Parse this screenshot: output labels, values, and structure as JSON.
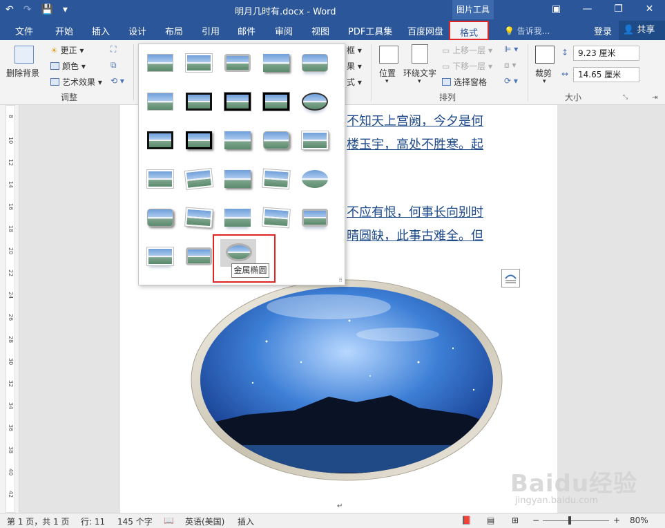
{
  "window": {
    "title": "明月几时有.docx - Word",
    "context_label": "图片工具",
    "controls": [
      "▣",
      "—",
      "❐",
      "✕"
    ]
  },
  "quick_access": [
    "↶",
    "↷",
    "💾",
    "▾"
  ],
  "tabs": [
    {
      "label": "文件"
    },
    {
      "label": "开始"
    },
    {
      "label": "插入"
    },
    {
      "label": "设计"
    },
    {
      "label": "布局"
    },
    {
      "label": "引用"
    },
    {
      "label": "邮件"
    },
    {
      "label": "审阅"
    },
    {
      "label": "视图"
    },
    {
      "label": "PDF工具集"
    },
    {
      "label": "百度网盘"
    },
    {
      "label": "格式"
    }
  ],
  "tell_me": "告诉我...",
  "login": "登录",
  "share": "共享",
  "ribbon": {
    "remove_bg": "删除背景",
    "corrections": "更正",
    "color": "颜色",
    "artistic": "艺术效果",
    "group_adjust": "调整",
    "border": "框",
    "effects": "果",
    "layout_trunc": "式",
    "position": "位置",
    "wrap_text": "环绕文字",
    "bring_forward": "上移一层",
    "send_backward": "下移一层",
    "selection_pane": "选择窗格",
    "group_arrange": "排列",
    "crop": "裁剪",
    "height": "9.23 厘米",
    "width": "14.65 厘米",
    "group_size": "大小"
  },
  "document": {
    "lines": [
      "不知天上宫阙，今夕是何",
      "楼玉宇，高处不胜寒。起",
      "不应有恨，何事长向别时",
      "晴圆缺，此事古难全。但"
    ],
    "para_mark": "↵"
  },
  "ruler": [
    "8",
    "10",
    "12",
    "14",
    "16",
    "18",
    "20",
    "22",
    "24",
    "26",
    "28",
    "30",
    "32",
    "34",
    "36",
    "38",
    "40",
    "42"
  ],
  "gallery": {
    "tooltip": "金属椭圆",
    "styles": [
      "simple-frame-white",
      "beveled-matte-white",
      "metal-frame",
      "drop-shadow-rectangle",
      "reflected-rounded-rectangle",
      "soft-edge-rectangle",
      "double-frame-black",
      "thick-matte-black",
      "simple-frame-black",
      "beveled-oval-black",
      "compound-frame-black",
      "center-shadow-rectangle",
      "rounded-diagonal-corner",
      "snip-diagonal-corner",
      "moderate-frame-white",
      "rotated-white",
      "perspective-shadow",
      "relaxed-perspective",
      "soft-edge-oval",
      "bevel-rectangle",
      "bevel-perspective",
      "reflected-bevel-black",
      "bevel-perspective-left",
      "metal-rounded-rectangle",
      "reflected-perspective-right",
      "simple-frame-reflected",
      "metal-oval-frame",
      "metal-oval"
    ]
  },
  "status": {
    "page": "第 1 页，共 1 页",
    "line": "行: 11",
    "words": "145 个字",
    "language": "英语(美国)",
    "mode": "插入",
    "zoom": "80%"
  },
  "watermark": {
    "brand": "Baidu经验",
    "url": "jingyan.baidu.com"
  }
}
